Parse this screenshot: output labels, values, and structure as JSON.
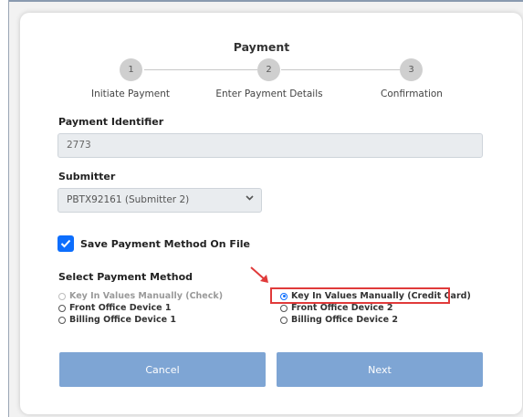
{
  "header": {
    "title": "Payment"
  },
  "stepper": {
    "steps": [
      {
        "number": "1",
        "label": "Initiate Payment"
      },
      {
        "number": "2",
        "label": "Enter Payment Details"
      },
      {
        "number": "3",
        "label": "Confirmation"
      }
    ]
  },
  "payment_identifier": {
    "label": "Payment Identifier",
    "value": "2773"
  },
  "submitter": {
    "label": "Submitter",
    "selected": "PBTX92161 (Submitter 2)"
  },
  "save_method": {
    "label": "Save Payment Method On File",
    "checked": true
  },
  "payment_method": {
    "label": "Select Payment Method",
    "options_left": [
      {
        "label": "Key In Values Manually (Check)",
        "disabled": true,
        "selected": false
      },
      {
        "label": "Front Office Device 1",
        "disabled": false,
        "selected": false
      },
      {
        "label": "Billing Office Device 1",
        "disabled": false,
        "selected": false
      }
    ],
    "options_right": [
      {
        "label": "Key In Values Manually (Credit Card)",
        "disabled": false,
        "selected": true
      },
      {
        "label": "Front Office Device 2",
        "disabled": false,
        "selected": false
      },
      {
        "label": "Billing Office Device 2",
        "disabled": false,
        "selected": false
      }
    ]
  },
  "buttons": {
    "cancel": "Cancel",
    "next": "Next"
  },
  "colors": {
    "accent": "#0d6efd",
    "button": "#7ea5d4",
    "highlight": "#e03a3a"
  }
}
